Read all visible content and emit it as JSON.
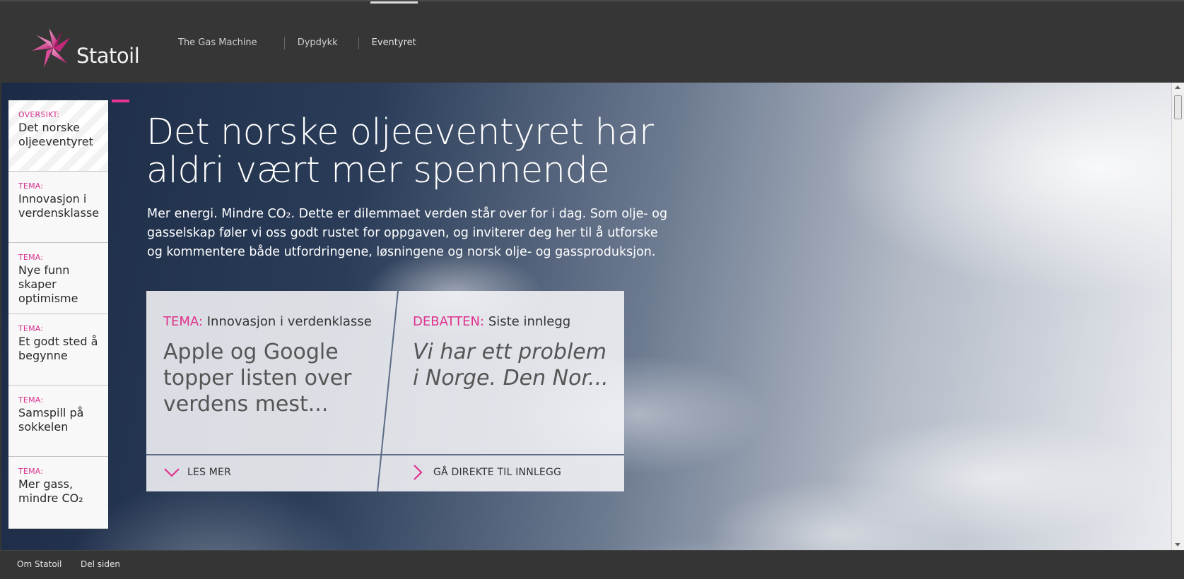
{
  "brand": {
    "name": "Statoil",
    "logo_icon": "statoil-star-icon",
    "accent_color": "#e0318c"
  },
  "nav": {
    "items": [
      {
        "label": "The Gas Machine"
      },
      {
        "label": "Dypdykk"
      },
      {
        "label": "Eventyret",
        "active": true
      }
    ]
  },
  "sidebar": {
    "items": [
      {
        "tag": "OVERSIKT:",
        "title": "Det norske oljeeventyret"
      },
      {
        "tag": "TEMA:",
        "title": "Innovasjon i verdensklasse"
      },
      {
        "tag": "TEMA:",
        "title": "Nye funn skaper optimisme"
      },
      {
        "tag": "TEMA:",
        "title": "Et godt sted å begynne"
      },
      {
        "tag": "TEMA:",
        "title": "Samspill på sokkelen"
      },
      {
        "tag": "TEMA:",
        "title": "Mer gass, mindre CO₂"
      }
    ]
  },
  "hero": {
    "headline": "Det norske oljeeventyret har aldri vært mer spennende",
    "intro": "Mer energi. Mindre CO₂. Dette er dilemmaet verden står over for i dag. Som olje- og gasselskap føler vi oss godt rustet for oppgaven, og inviterer deg her til å utforske og kommentere både utfordringene, løsningene og norsk olje- og gassproduksjon."
  },
  "cards": {
    "left": {
      "tag": "TEMA:",
      "subtitle": "Innovasjon i verdenklasse",
      "body": "Apple og Google topper listen over verdens mest...",
      "link": "LES MER",
      "link_icon": "chevron-down-icon"
    },
    "right": {
      "tag": "DEBATTEN:",
      "subtitle": "Siste innlegg",
      "body": "Vi har ett problem i Norge. Den Nor...",
      "link": "GÅ DIREKTE TIL INNLEGG",
      "link_icon": "chevron-right-icon"
    }
  },
  "footer": {
    "links": [
      {
        "label": "Om Statoil"
      },
      {
        "label": "Del siden"
      }
    ]
  }
}
